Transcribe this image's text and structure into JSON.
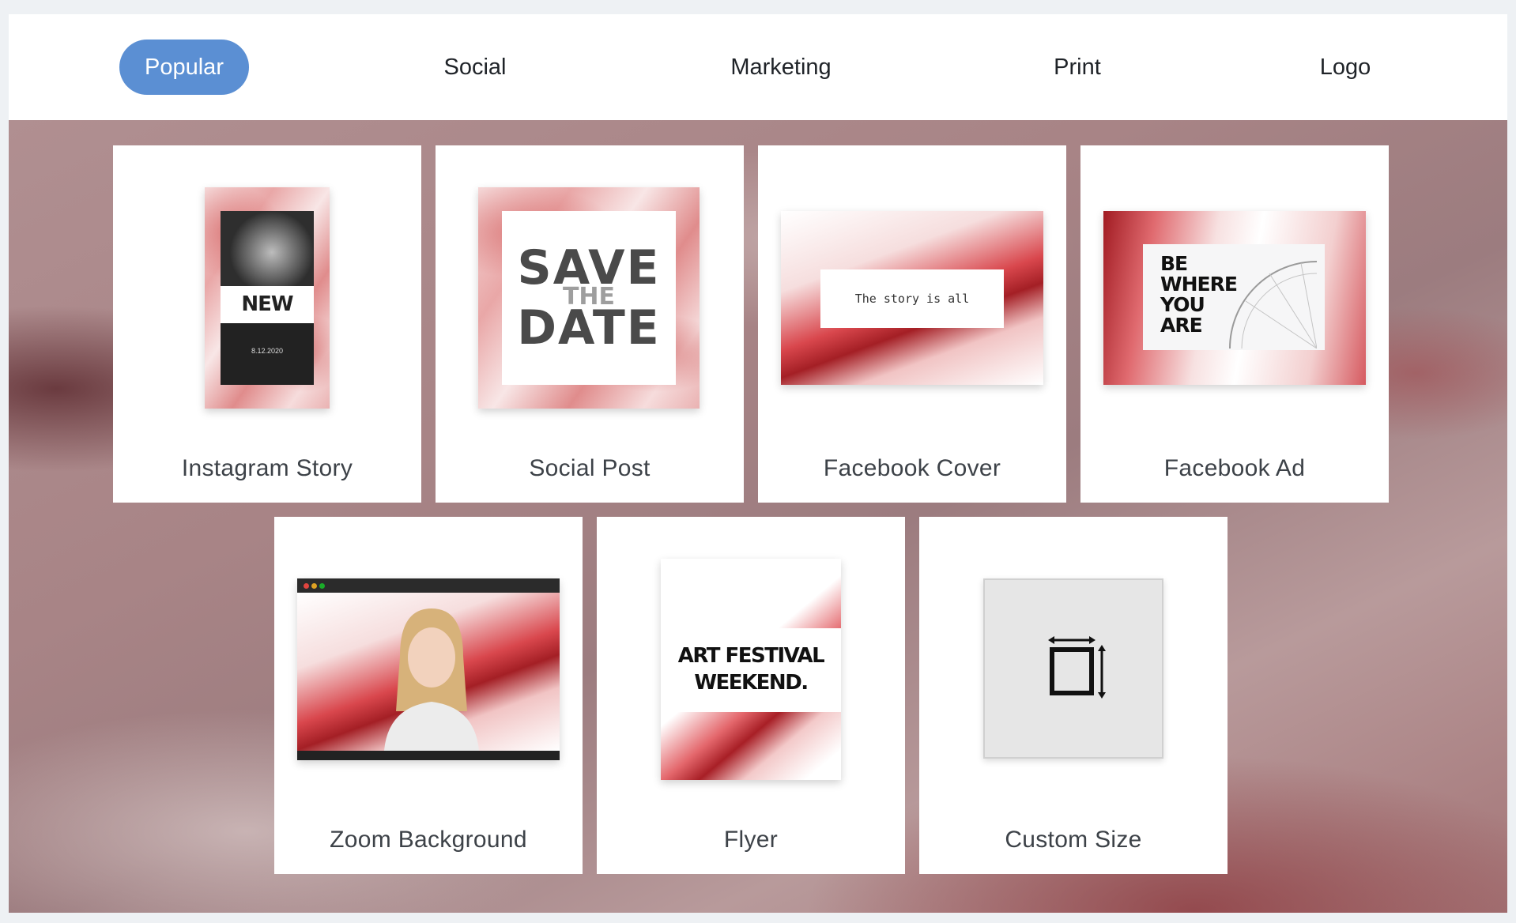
{
  "tabs": [
    {
      "label": "Popular",
      "active": true
    },
    {
      "label": "Social",
      "active": false
    },
    {
      "label": "Marketing",
      "active": false
    },
    {
      "label": "Print",
      "active": false
    },
    {
      "label": "Logo",
      "active": false
    }
  ],
  "cards": [
    {
      "label": "Instagram Story",
      "thumb_text": [
        "NEW",
        "8.12.2020"
      ]
    },
    {
      "label": "Social Post",
      "thumb_text": [
        "SAVE",
        "THE",
        "DATE"
      ]
    },
    {
      "label": "Facebook Cover",
      "thumb_text": [
        "The story is all"
      ]
    },
    {
      "label": "Facebook Ad",
      "thumb_text": [
        "BE",
        "WHERE",
        "YOU",
        "ARE"
      ]
    },
    {
      "label": "Zoom Background"
    },
    {
      "label": "Flyer",
      "thumb_text": [
        "ART FESTIVAL",
        "WEEKEND."
      ]
    },
    {
      "label": "Custom Size",
      "icon": "resize-icon"
    }
  ],
  "colors": {
    "active_tab": "#5b8fd3",
    "accent_red": "#c3363c"
  }
}
